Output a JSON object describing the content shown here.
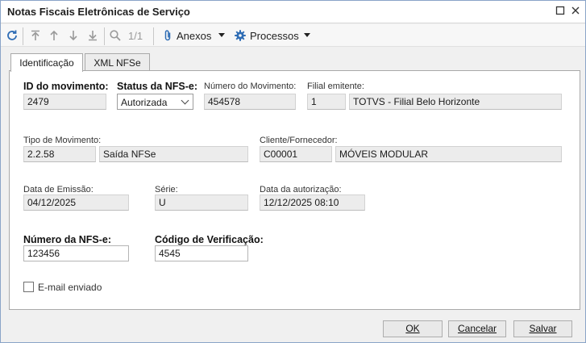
{
  "window": {
    "title": "Notas Fiscais Eletrônicas de Serviço"
  },
  "toolbar": {
    "page_indicator": "1/1",
    "anexos_label": "Anexos",
    "processos_label": "Processos"
  },
  "tabs": [
    {
      "label": "Identificação",
      "active": true
    },
    {
      "label": "XML NFSe",
      "active": false
    }
  ],
  "form": {
    "id_movimento": {
      "label": "ID do movimento:",
      "value": "2479"
    },
    "status_nfse": {
      "label": "Status da NFS-e:",
      "value": "Autorizada"
    },
    "numero_movimento": {
      "label": "Número do Movimento:",
      "value": "454578"
    },
    "filial_emitente": {
      "label": "Filial emitente:",
      "code": "1",
      "name": "TOTVS - Filial Belo Horizonte"
    },
    "tipo_movimento": {
      "label": "Tipo de Movimento:",
      "code": "2.2.58",
      "name": "Saída NFSe"
    },
    "cliente_fornecedor": {
      "label": "Cliente/Fornecedor:",
      "code": "C00001",
      "name": "MÓVEIS MODULAR"
    },
    "data_emissao": {
      "label": "Data de Emissão:",
      "value": "04/12/2025"
    },
    "serie": {
      "label": "Série:",
      "value": "U"
    },
    "data_autorizacao": {
      "label": "Data da autorização:",
      "value": "12/12/2025 08:10"
    },
    "numero_nfse": {
      "label": "Número da NFS-e:",
      "value": "123456"
    },
    "codigo_verificacao": {
      "label": "Código de Verificação:",
      "value": "4545"
    },
    "email_enviado": {
      "label": "E-mail enviado",
      "checked": false
    }
  },
  "footer": {
    "ok_label": "OK",
    "cancel_label": "Cancelar",
    "save_label": "Salvar"
  },
  "colors": {
    "accent_blue": "#2f6db5",
    "field_readonly": "#ececec"
  }
}
